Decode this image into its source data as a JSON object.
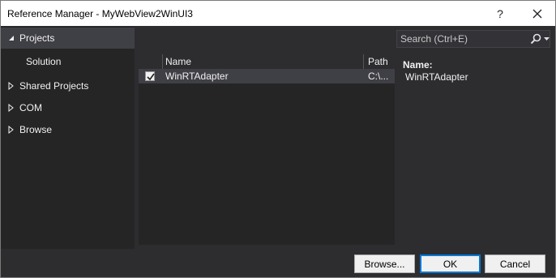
{
  "window": {
    "title": "Reference Manager - MyWebView2WinUI3",
    "help_label": "?"
  },
  "nav": {
    "items": [
      {
        "label": "Projects",
        "expanded": true,
        "selected": true
      },
      {
        "label": "Solution",
        "child": true
      },
      {
        "label": "Shared Projects",
        "expanded": false
      },
      {
        "label": "COM",
        "expanded": false
      },
      {
        "label": "Browse",
        "expanded": false
      }
    ]
  },
  "list": {
    "columns": [
      "Name",
      "Path"
    ],
    "rows": [
      {
        "checked": true,
        "name": "WinRTAdapter",
        "path": "C:\\..."
      }
    ]
  },
  "search": {
    "placeholder": "Search (Ctrl+E)",
    "icon": "search-icon"
  },
  "details": {
    "name_key": "Name:",
    "name_value": "WinRTAdapter"
  },
  "footer": {
    "browse_label": "Browse...",
    "ok_label": "OK",
    "cancel_label": "Cancel"
  },
  "colors": {
    "background": "#2d2d30",
    "panel": "#252526",
    "selected": "#3f3f46",
    "accent": "#0078d7"
  }
}
